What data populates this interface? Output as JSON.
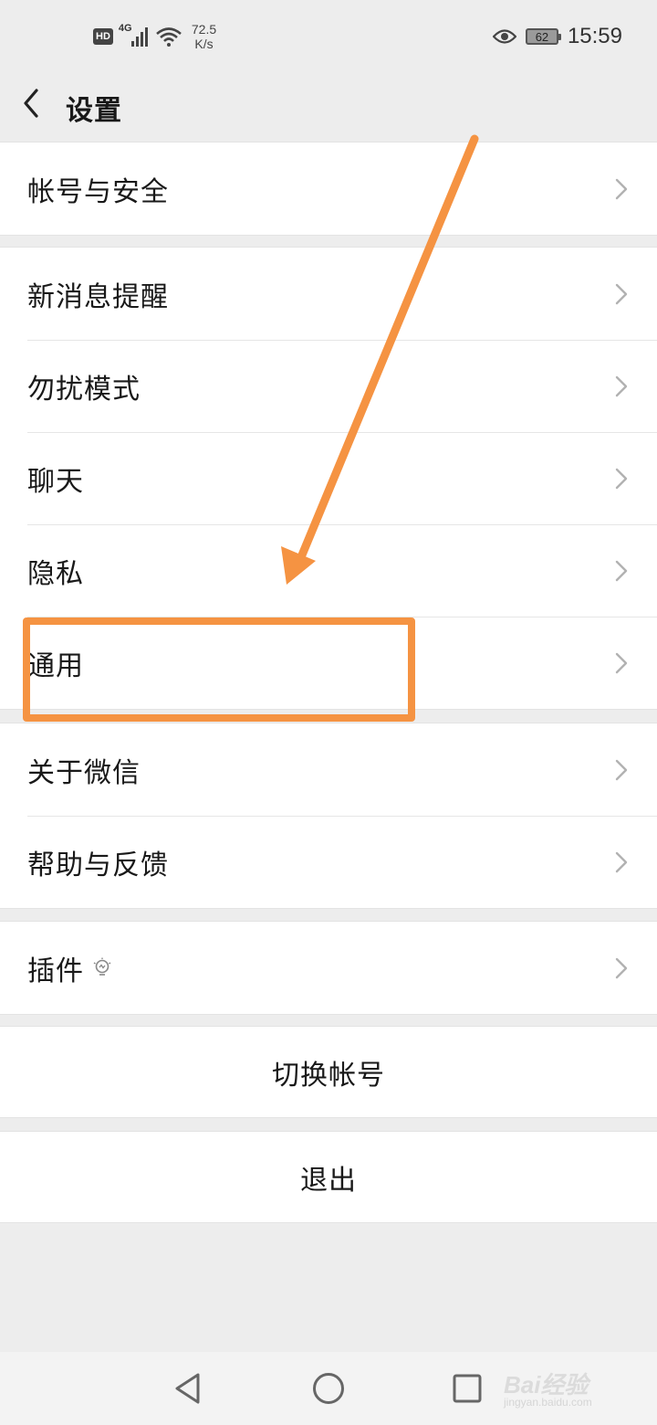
{
  "status_bar": {
    "hd_badge": "HD",
    "network_type": "4G",
    "speed_value": "72.5",
    "speed_unit": "K/s",
    "battery_level": "62",
    "time": "15:59",
    "icons": [
      "signal-icon",
      "wifi-icon",
      "eye-icon",
      "battery-icon"
    ]
  },
  "header": {
    "title": "设置",
    "back_icon": "chevron-left-icon"
  },
  "groups": [
    {
      "items": [
        {
          "label": "帐号与安全"
        }
      ]
    },
    {
      "items": [
        {
          "label": "新消息提醒"
        },
        {
          "label": "勿扰模式"
        },
        {
          "label": "聊天"
        },
        {
          "label": "隐私"
        },
        {
          "label": "通用"
        }
      ]
    },
    {
      "items": [
        {
          "label": "关于微信"
        },
        {
          "label": "帮助与反馈"
        }
      ]
    },
    {
      "items": [
        {
          "label": "插件",
          "icon": "lightbulb-icon"
        }
      ]
    }
  ],
  "actions": {
    "switch_account": "切换帐号",
    "logout": "退出"
  },
  "annotation": {
    "color": "#f59342",
    "highlighted_item": "通用"
  },
  "watermark": {
    "main": "Bai经验",
    "sub": "jingyan.baidu.com"
  },
  "nav_bar": {
    "icons": [
      "back-triangle-icon",
      "home-circle-icon",
      "recents-square-icon"
    ]
  }
}
